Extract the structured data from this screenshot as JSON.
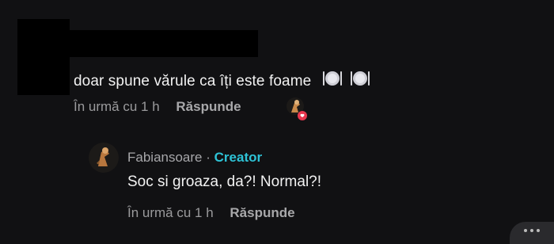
{
  "comment": {
    "text": "doar spune vărule ca îți este foame",
    "emojis": [
      "plate-with-cutlery-icon",
      "plate-with-cutlery-icon"
    ],
    "time": "În urmă cu 1 h",
    "reply_label": "Răspunde"
  },
  "reply": {
    "author": "Fabiansoare",
    "separator": "·",
    "badge": "Creator",
    "text": "Soc si groaza, da?! Normal?!",
    "time": "În urmă cu 1 h",
    "reply_label": "Răspunde"
  },
  "colors": {
    "background": "#111113",
    "creator_badge": "#2ec3d6",
    "heart": "#e8374f"
  }
}
